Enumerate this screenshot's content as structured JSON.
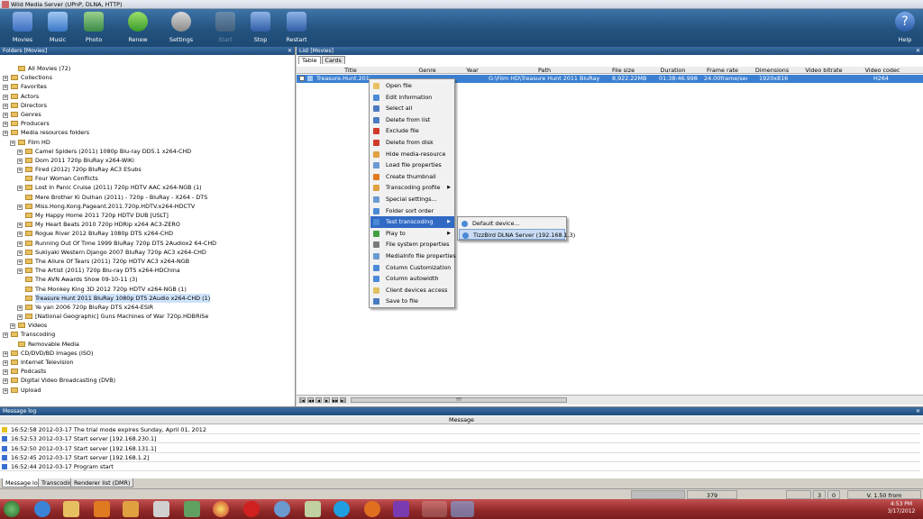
{
  "window": {
    "title": "Wild Media Server (UPnP, DLNA, HTTP)"
  },
  "toolbar": {
    "movies": "Movies",
    "music": "Music",
    "photo": "Photo",
    "renew": "Renew",
    "settings": "Settings",
    "start": "Start",
    "stop": "Stop",
    "restart": "Restart",
    "help": "Help"
  },
  "left_pane": {
    "header": "Folders [Movies]",
    "tree": [
      "All Movies (72)",
      "Collections",
      "Favorites",
      "Actors",
      "Directors",
      "Genres",
      "Producers",
      "Media resources folders",
      "Film HD",
      "Camel Spiders (2011) 1080p Blu-ray DD5.1 x264-CHD",
      "Dom 2011 720p BluRay x264-WiKi",
      "Fired (2012) 720p BluRay AC3 ESubs",
      "Four Woman Conflicts",
      "Lost In Panic Cruise (2011) 720p HDTV AAC x264-NGB (1)",
      "Mere Brother Ki Dulhan (2011) - 720p - BluRay - X264 - DTS",
      "Miss.Hong.Kong.Pageant.2011.720p.HDTV.x264-HDCTV",
      "My Happy Home 2011 720p HDTV DUB [USLT]",
      "My Heart Beats 2010 720p HDRip x264 AC3-ZERO",
      "Rogue River 2012 BluRay 1080p DTS x264-CHD",
      "Running Out Of Time 1999 BluRay 720p DTS 2Audiox2 64-CHD",
      "Sukiyaki Western Django 2007 BluRay 720p AC3 x264-CHD",
      "The Allure Of Tears (2011) 720p HDTV AC3 x264-NGB",
      "The Artist (2011) 720p Blu-ray DTS x264-HDChina",
      "The AVN Awards Show 09-10-11 (3)",
      "The Monkey King 3D 2012 720p HDTV x264-NGB (1)",
      "Treasure Hunt 2011 BluRay 1080p DTS 2Audio x264-CHD (1)",
      "Ye yan 2006 720p BluRay DTS x264-ESiR",
      "[National Geographic] Guns Machines of War 720p.HDBRiSe",
      "Videos",
      "Transcoding",
      "Removable Media",
      "CD/DVD/BD Images (ISO)",
      "Internet Television",
      "Podcasts",
      "Digital Video Broadcasting (DVB)",
      "Upload"
    ]
  },
  "right_pane": {
    "header": "List [Movies]",
    "tabs": [
      "Table",
      "Cards"
    ],
    "columns": [
      "Title",
      "Genre",
      "Year",
      "Path",
      "File size",
      "Duration",
      "Frame rate",
      "Dimensions",
      "Video bitrate",
      "Video codec"
    ],
    "row": {
      "title": "Treasure.Hunt.2011.B",
      "path": "G:\\Film HD\\Treasure Hunt 2011 BluRay 1080p D",
      "size": "8,922.22MB",
      "duration": "01:38:46.998",
      "frame_rate": "24.00frame/sec",
      "dimensions": "1920x816",
      "codec": "H264"
    },
    "nav": [
      "|◀",
      "◀◀",
      "◀",
      "▶",
      "▶▶",
      "▶|"
    ],
    "scroll_thumb": "!!!"
  },
  "context_menu": [
    "Open file",
    "Edit information",
    "Select all",
    "Delete from list",
    "Exclude file",
    "Delete from disk",
    "Hide media-resource",
    "Load file properties",
    "Create thumbnail",
    "Transcoding profile",
    "Special settings...",
    "Folder sort order",
    "Test transcoding",
    "Play to",
    "File system properties",
    "MediaInfo file properties",
    "Column Customization",
    "Column autowidth",
    "Client devices access",
    "Save to file"
  ],
  "submenu": [
    "Default device...",
    "TizzBird DLNA Server (192.168.1.3)"
  ],
  "message_log": {
    "header": "Message log",
    "column": "Message",
    "lines": [
      "16:52:58 2012-03-17 The trial mode expires Sunday, April 01, 2012",
      "16:52:53 2012-03-17 Start server [192.168.230.1]",
      "16:52:50 2012-03-17 Start server [192.168.131.1]",
      "16:52:45 2012-03-17 Start server [192.168.1.2]",
      "16:52:44 2012-03-17 Program start"
    ]
  },
  "bottom_tabs": [
    "Message log",
    "Transcoding",
    "Renderer list (DMR)"
  ],
  "status": {
    "count": "379",
    "a": "3",
    "b": "0",
    "version": "V. 1.50 from 03.09.2012"
  },
  "clock": {
    "time": "4:53 PM",
    "date": "3/17/2012"
  },
  "colors": {
    "toolbar": "#23527e",
    "selection": "#3a7fd2",
    "menu_highlight": "#316ac5",
    "taskbar": "#902828"
  }
}
